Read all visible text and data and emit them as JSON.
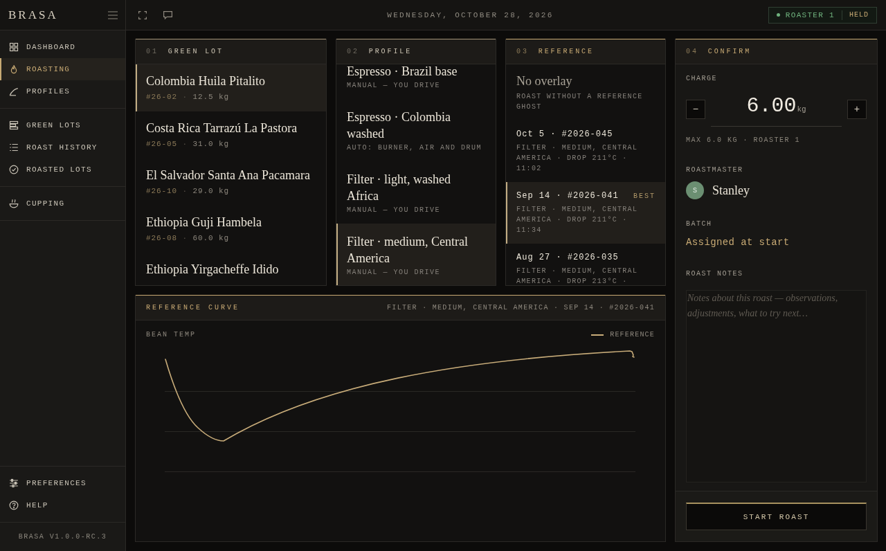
{
  "sidebar": {
    "logo": "BRASA",
    "groups": [
      {
        "items": [
          {
            "label": "DASHBOARD",
            "selected": false
          },
          {
            "label": "ROASTING",
            "selected": true
          },
          {
            "label": "PROFILES",
            "selected": false
          }
        ]
      },
      {
        "items": [
          {
            "label": "GREEN LOTS",
            "selected": false
          },
          {
            "label": "ROAST HISTORY",
            "selected": false
          },
          {
            "label": "ROASTED LOTS",
            "selected": false
          }
        ]
      },
      {
        "items": [
          {
            "label": "CUPPING",
            "selected": false
          }
        ]
      }
    ],
    "footer_items": [
      {
        "label": "PREFERENCES",
        "selected": false
      },
      {
        "label": "HELP",
        "selected": false
      }
    ],
    "version": "BRASA V1.0.0-RC.3"
  },
  "top_bar": {
    "date": "WEDNESDAY, OCTOBER 28, 2026",
    "roaster": {
      "name": "ROASTER 1",
      "state": "HELD"
    }
  },
  "green_lot": {
    "number": "01",
    "title": "GREEN LOT",
    "highlighted": false,
    "lots": [
      {
        "name": "Colombia Huila Pitalito",
        "lot": "#26-02",
        "separator": "·",
        "weight": "12.5 kg",
        "selected": true
      },
      {
        "name": "Costa Rica Tarrazú La Pastora",
        "lot": "#26-05",
        "separator": "·",
        "weight": "31.0 kg",
        "selected": false
      },
      {
        "name": "El Salvador Santa Ana Pacamara",
        "lot": "#26-10",
        "separator": "·",
        "weight": "29.0 kg",
        "selected": false
      },
      {
        "name": "Ethiopia Guji Hambela",
        "lot": "#26-08",
        "separator": "·",
        "weight": "60.0 kg",
        "selected": false
      },
      {
        "name": "Ethiopia Yirgacheffe Idido",
        "selected": false
      }
    ]
  },
  "profile": {
    "number": "02",
    "title": "PROFILE",
    "highlighted": false,
    "profiles": [
      {
        "name": "Espresso · Brazil base",
        "mode": "MANUAL — YOU DRIVE",
        "selected": false
      },
      {
        "name": "Espresso · Colombia washed",
        "mode": "AUTO: BURNER, AIR AND DRUM",
        "selected": false
      },
      {
        "name": "Filter · light, washed Africa",
        "mode": "MANUAL — YOU DRIVE",
        "selected": false
      },
      {
        "name": "Filter · medium, Central America",
        "mode": "MANUAL — YOU DRIVE",
        "selected": true
      }
    ]
  },
  "reference": {
    "number": "03",
    "title": "REFERENCE",
    "highlighted": true,
    "options": [
      {
        "kind": "none",
        "title": "No overlay",
        "detail": "ROAST WITHOUT A REFERENCE GHOST",
        "selected": false
      },
      {
        "kind": "roast",
        "title": "Oct 5 · #2026-045",
        "detail": "FILTER · MEDIUM, CENTRAL AMERICA · DROP 211°C · 11:02",
        "selected": false
      },
      {
        "kind": "roast",
        "title": "Sep 14 · #2026-041",
        "tag": "BEST",
        "detail": "FILTER · MEDIUM, CENTRAL AMERICA · DROP 211°C · 11:34",
        "selected": true
      },
      {
        "kind": "roast",
        "title": "Aug 27 · #2026-035",
        "detail": "FILTER · MEDIUM, CENTRAL AMERICA · DROP 213°C ·",
        "selected": false
      }
    ]
  },
  "confirm": {
    "number": "04",
    "title": "CONFIRM",
    "highlighted": true,
    "charge": {
      "label": "CHARGE",
      "decrease": "−",
      "value": "6.00",
      "unit": "kg",
      "increase": "+",
      "limit": "MAX 6.0 KG · ROASTER 1"
    },
    "roastmaster": {
      "label": "ROASTMASTER",
      "initial": "S",
      "name": "Stanley"
    },
    "batch": {
      "label": "BATCH",
      "value": "Assigned at start"
    },
    "notes": {
      "label": "ROAST NOTES",
      "placeholder": "Notes about this roast — observations, adjustments, what to try next…"
    },
    "start_button": "START ROAST"
  },
  "reference_curve": {
    "title": "REFERENCE CURVE",
    "source": "FILTER · MEDIUM, CENTRAL AMERICA · SEP 14 · #2026-041",
    "axis_label": "BEAN TEMP",
    "legend": "REFERENCE"
  }
}
